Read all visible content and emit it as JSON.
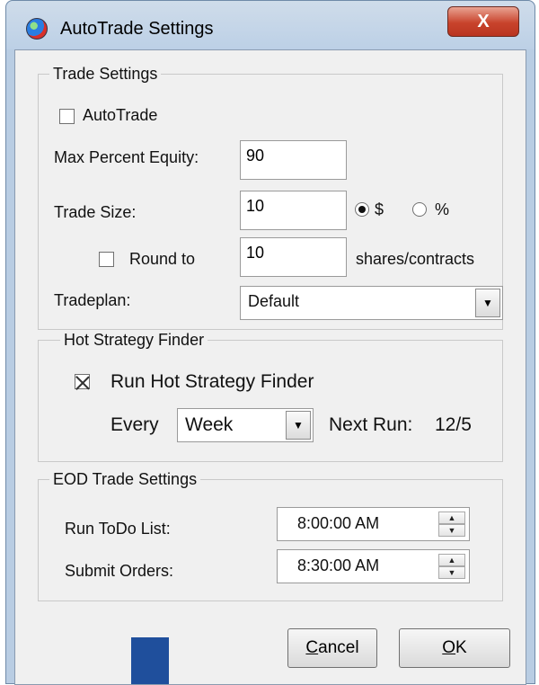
{
  "window": {
    "title": "AutoTrade Settings",
    "close_glyph": "X"
  },
  "trade_settings": {
    "legend": "Trade Settings",
    "autotrade_label": "AutoTrade",
    "autotrade_checked": false,
    "max_percent_equity_label": "Max Percent Equity:",
    "max_percent_equity_value": "90",
    "trade_size_label": "Trade Size:",
    "trade_size_value": "10",
    "size_unit_options": [
      "$",
      "%"
    ],
    "size_unit_selected": "$",
    "round_to_label": "Round to",
    "round_to_checked": false,
    "round_to_value": "10",
    "round_to_unit": "shares/contracts",
    "tradeplan_label": "Tradeplan:",
    "tradeplan_value": "Default"
  },
  "hot_strategy": {
    "legend": "Hot Strategy Finder",
    "run_label": "Run Hot Strategy Finder",
    "run_checked": true,
    "every_label": "Every",
    "every_value": "Week",
    "next_run_label": "Next Run:",
    "next_run_value": "12/5"
  },
  "eod": {
    "legend": "EOD Trade Settings",
    "run_todo_label": "Run ToDo List:",
    "run_todo_time": "8:00:00 AM",
    "submit_orders_label": "Submit Orders:",
    "submit_orders_time": "8:30:00 AM"
  },
  "buttons": {
    "cancel_prefix": "C",
    "cancel_rest": "ancel",
    "ok_prefix": "O",
    "ok_rest": "K"
  },
  "icons": {
    "app": "app-globe-icon",
    "dropdown": "chevron-down-icon",
    "spin_up": "arrow-up-icon",
    "spin_down": "arrow-down-icon"
  },
  "colors": {
    "title_bar": "#bcd0e6",
    "close_button": "#c8432c",
    "client_bg": "#f0f0f0",
    "marker": "#1f4f9c"
  }
}
